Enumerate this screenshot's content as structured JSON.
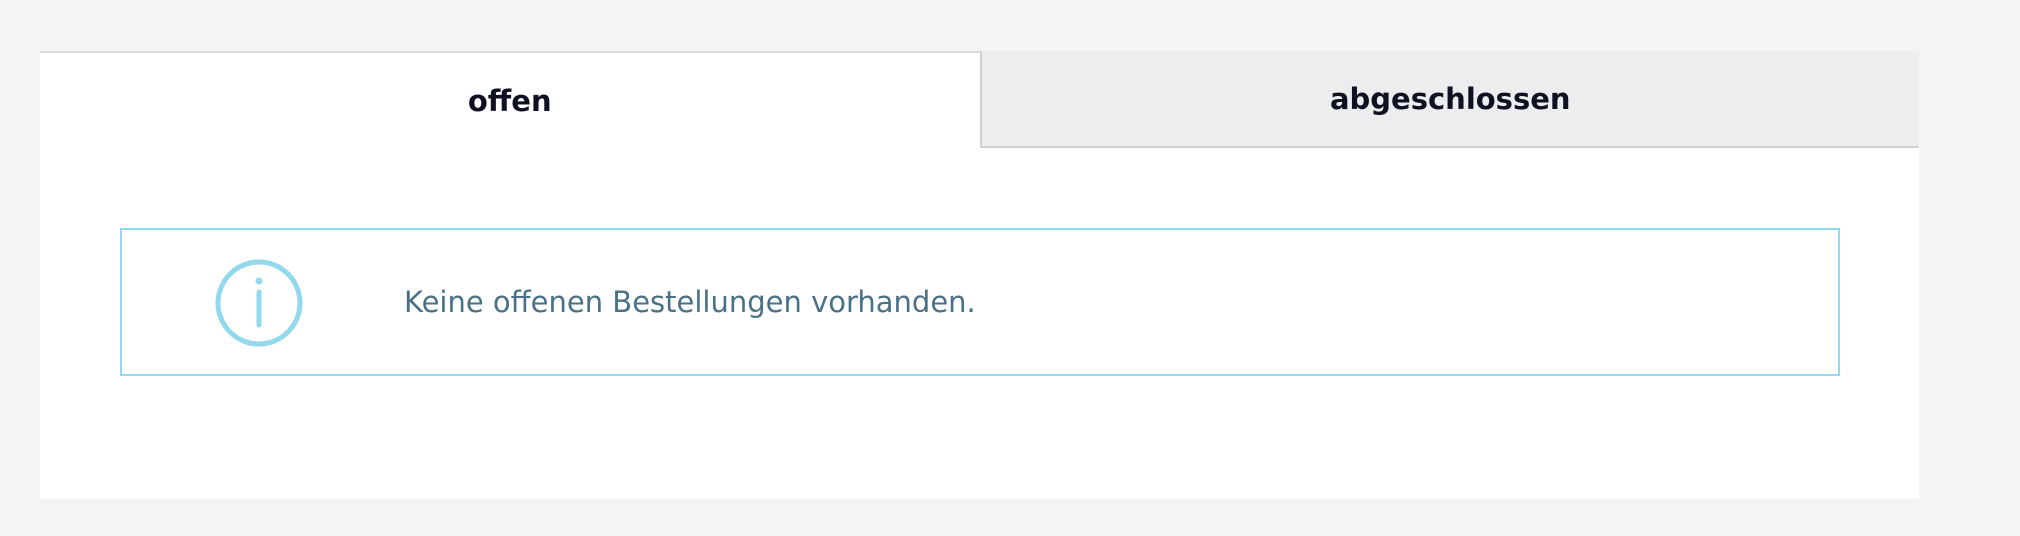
{
  "tabs": [
    {
      "label": "offen",
      "active": true
    },
    {
      "label": "abgeschlossen",
      "active": false
    }
  ],
  "notice": {
    "icon": "info-icon",
    "message": "Keine offenen Bestellungen vorhanden."
  },
  "colors": {
    "page_background": "#f3f4f6",
    "panel_background": "#ffffff",
    "inactive_tab_background": "#ecedef",
    "tab_text": "#0f1020",
    "info_accent": "#93d9ee",
    "info_text": "#4a7185"
  }
}
